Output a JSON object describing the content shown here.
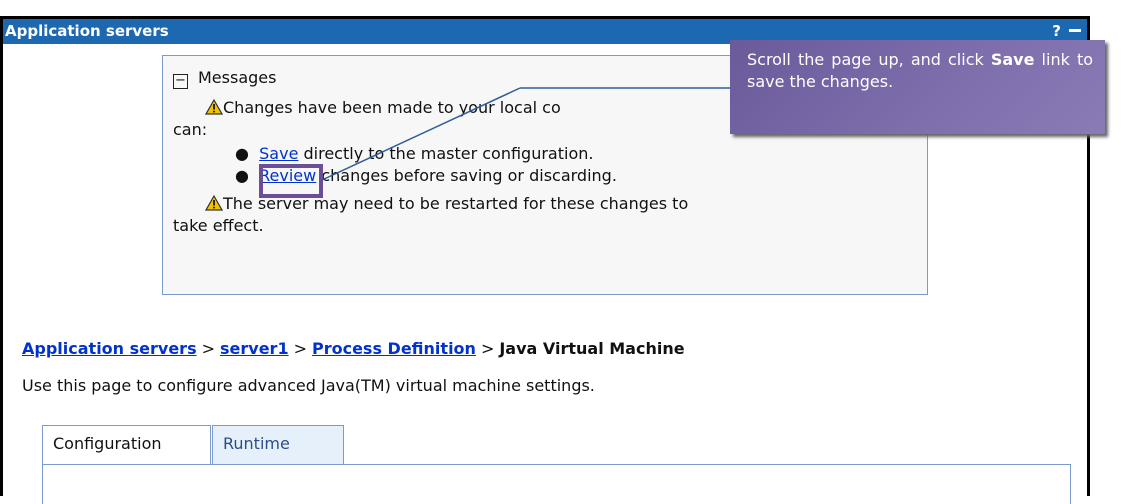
{
  "window": {
    "title": "Application servers",
    "help_label": "?"
  },
  "messages": {
    "header": "Messages",
    "line1": "Changes have been made to your local co",
    "line1b": "can:",
    "save_link": "Save",
    "save_rest": " directly to the master configuration.",
    "review_link": "Review",
    "review_rest": " changes before saving or discarding.",
    "line4": "The server may need to be restarted for these changes to",
    "line4b": "take effect."
  },
  "callout": {
    "text_before": "Scroll the page up, and click ",
    "bold": "Save",
    "text_after": " link to save the changes."
  },
  "breadcrumb": {
    "items": [
      "Application servers",
      "server1",
      "Process Definition"
    ],
    "current": "Java Virtual Machine",
    "separator": ">"
  },
  "page_description": "Use this page to configure advanced Java(TM) virtual machine settings.",
  "tabs": [
    {
      "label": "Configuration",
      "selected": true
    },
    {
      "label": "Runtime",
      "selected": false
    }
  ],
  "colors": {
    "titlebar": "#1c69b2",
    "link": "#0033cc",
    "callout": "#7f6fad",
    "highlight": "#6b4e98"
  },
  "icons": {
    "warning": "warning-icon",
    "collapse": "collapse-minus-icon",
    "minimize": "minimize-icon"
  }
}
